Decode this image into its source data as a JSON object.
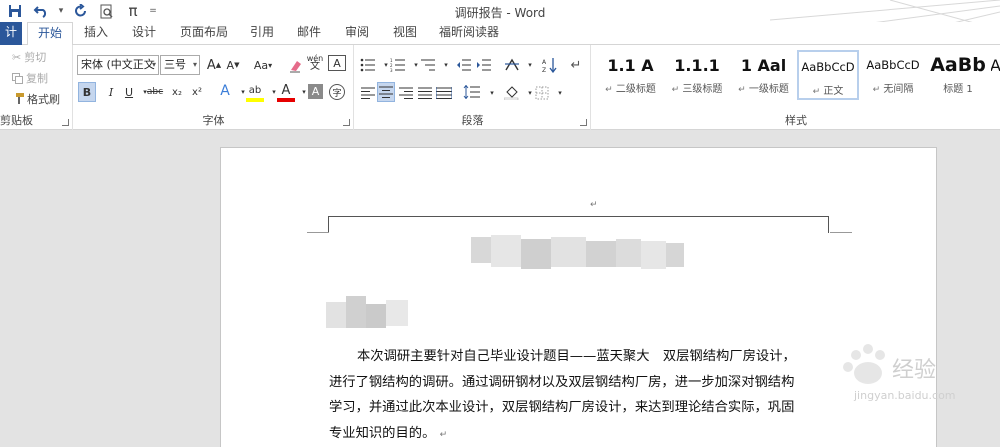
{
  "window": {
    "title": "调研报告 - Word"
  },
  "qat": {
    "more": "π",
    "dropdown": "="
  },
  "tabs": {
    "file": "计",
    "items": [
      "开始",
      "插入",
      "设计",
      "页面布局",
      "引用",
      "邮件",
      "审阅",
      "视图",
      "福昕阅读器"
    ]
  },
  "clipboard": {
    "cut": "剪切",
    "copy": "复制",
    "format_painter": "格式刷",
    "group_label": "剪贴板"
  },
  "font": {
    "name": "宋体 (中文正文",
    "size": "三号",
    "grow": "A",
    "shrink": "A",
    "case": "Aa",
    "phonetic": "wén",
    "border_char": "A",
    "bold": "B",
    "italic": "I",
    "underline": "U",
    "strike": "abc",
    "sub": "x₂",
    "sup": "x²",
    "effects": "A",
    "highlight": "ab",
    "color": "A",
    "shading": "A",
    "enclose": "字",
    "group_label": "字体"
  },
  "paragraph": {
    "group_label": "段落"
  },
  "styles": {
    "group_label": "样式",
    "items": [
      {
        "sample": "1.1 A",
        "name": "二级标题"
      },
      {
        "sample": "1.1.1",
        "name": "三级标题"
      },
      {
        "sample": "1 Aal",
        "name": "一级标题"
      },
      {
        "sample": "AaBbCcD",
        "name": "正文"
      },
      {
        "sample": "AaBbCcD",
        "name": "无间隔"
      },
      {
        "sample": "AaBb",
        "name": "标题 1"
      },
      {
        "sample": "A",
        "name": ""
      }
    ]
  },
  "document": {
    "paragraph_lines": [
      "本次调研主要针对自己毕业设计题目——蓝天聚大　双层钢结构厂房设计，",
      "进行了钢结构的调研。通过调研钢材以及双层钢结构厂房，进一步加深对钢结构",
      "学习，并通过此次本业设计，双层钢结构厂房设计，来达到理论结合实际，巩固",
      "专业知识的目的。"
    ],
    "return_mark": "↵"
  },
  "watermark": {
    "text": "经验",
    "sub": "jingyan.baidu.com"
  },
  "colors": {
    "accent": "#2b579a",
    "selected_bg": "#c5d6ee"
  }
}
